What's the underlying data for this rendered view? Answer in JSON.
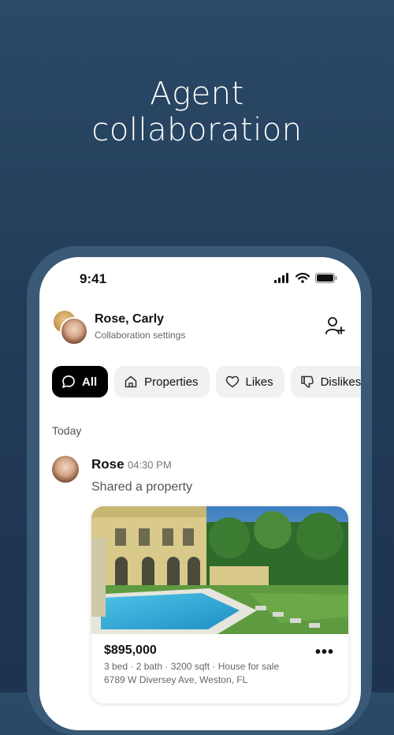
{
  "headline": {
    "line1": "Agent",
    "line2": "collaboration"
  },
  "status_bar": {
    "time": "9:41"
  },
  "header": {
    "name": "Rose, Carly",
    "subtitle": "Collaboration settings"
  },
  "filters": [
    {
      "label": "All",
      "icon": "chat-bubble-icon",
      "active": true
    },
    {
      "label": "Properties",
      "icon": "home-icon",
      "active": false
    },
    {
      "label": "Likes",
      "icon": "heart-icon",
      "active": false
    },
    {
      "label": "Dislikes",
      "icon": "thumbs-down-icon",
      "active": false
    }
  ],
  "feed": {
    "section": "Today",
    "message": {
      "sender": "Rose",
      "time": "04:30 PM",
      "text": "Shared a property",
      "property": {
        "price": "$895,000",
        "details": "3 bed · 2 bath · 3200 sqft · House for sale",
        "address": "6789 W Diversey Ave, Weston, FL"
      }
    }
  },
  "colors": {
    "background": "#223c58",
    "frame": "#3a5977",
    "active_chip": "#000000",
    "chip": "#f1f1f3"
  }
}
